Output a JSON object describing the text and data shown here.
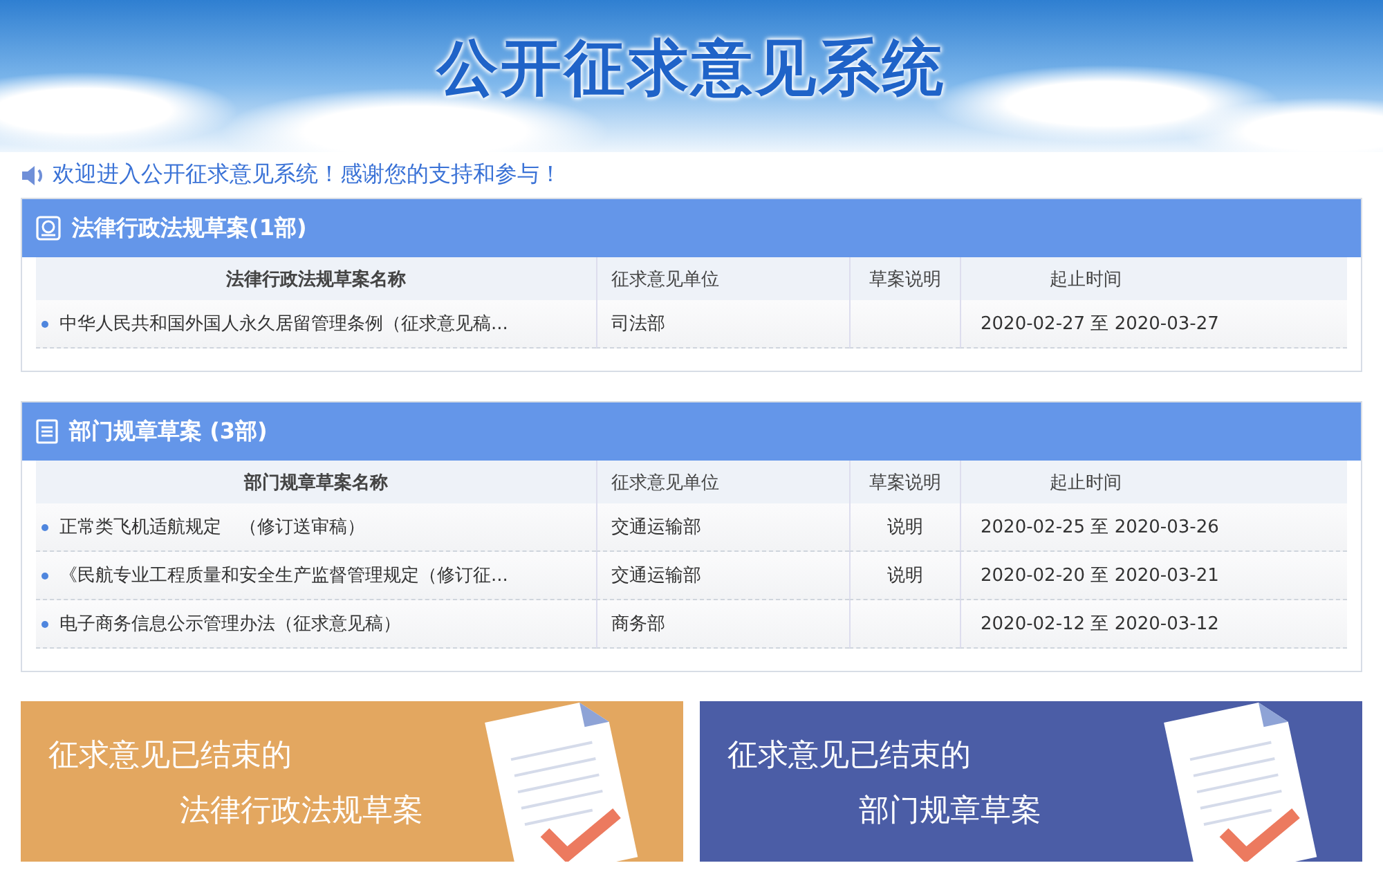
{
  "header": {
    "title": "公开征求意见系统"
  },
  "welcome": "欢迎进入公开征求意见系统！感谢您的支持和参与！",
  "sections": [
    {
      "title": "法律行政法规草案(1部)",
      "kind": "seal",
      "columns": [
        "法律行政法规草案名称",
        "征求意见单位",
        "草案说明",
        "起止时间"
      ],
      "rows": [
        {
          "name": "中华人民共和国外国人永久居留管理条例（征求意见稿...",
          "unit": "司法部",
          "period": "2020-02-27 至 2020-03-27"
        }
      ]
    },
    {
      "title": "部门规章草案 (3部)",
      "kind": "document",
      "columns": [
        "部门规章草案名称",
        "征求意见单位",
        "草案说明",
        "起止时间"
      ],
      "rows": [
        {
          "name": "正常类飞机适航规定　（修订送审稿）",
          "unit": "交通运输部",
          "note": "说明",
          "period": "2020-02-25 至 2020-03-26"
        },
        {
          "name": "《民航专业工程质量和安全生产监督管理规定（修订征...",
          "unit": "交通运输部",
          "note": "说明",
          "period": "2020-02-20 至 2020-03-21"
        },
        {
          "name": "电子商务信息公示管理办法（征求意见稿）",
          "unit": "商务部",
          "period": "2020-02-12 至 2020-03-12"
        }
      ]
    }
  ],
  "promos": [
    {
      "line1": "征求意见已结束的",
      "line2": "法律行政法规草案",
      "color": "#e3a760"
    },
    {
      "line1": "征求意见已结束的",
      "line2": "部门规章草案",
      "color": "#4b5da6"
    }
  ]
}
